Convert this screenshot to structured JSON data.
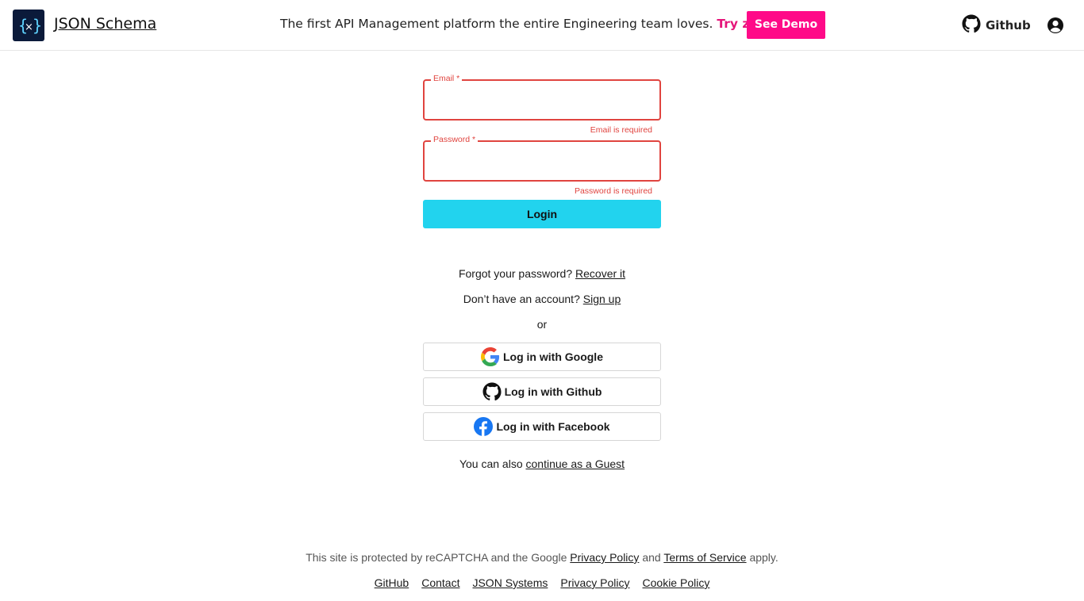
{
  "header": {
    "brand": "JSON Schema",
    "promo_text": "The first API Management platform the entire Engineering team loves.",
    "promo_link": "Try zuplo",
    "demo_button": "See Demo",
    "github_label": "Github",
    "logo_icon": "json-schema-logo-icon",
    "account_icon": "user-circle-icon"
  },
  "form": {
    "email_label": "Email *",
    "email_value": "",
    "email_error": "Email is required",
    "password_label": "Password *",
    "password_value": "",
    "password_error": "Password is required",
    "login_button": "Login"
  },
  "links": {
    "forgot_text": "Forgot your password?",
    "recover_link": "Recover it",
    "no_account_text": "Don’t have an account?",
    "signup_link": "Sign up",
    "or_text": "or"
  },
  "social": {
    "google": "Log in with Google",
    "github": "Log in with Github",
    "facebook": "Log in with Facebook"
  },
  "guest": {
    "text": "You can also",
    "link": "continue as a Guest"
  },
  "footer": {
    "recaptcha_text": "This site is protected by reCAPTCHA and the Google",
    "privacy_link": "Privacy Policy",
    "and_text": "and",
    "terms_link": "Terms of Service",
    "apply_text": "apply.",
    "links": [
      "GitHub",
      "Contact",
      "JSON Systems",
      "Privacy Policy",
      "Cookie Policy"
    ]
  },
  "colors": {
    "accent_pink": "#ff0a88",
    "error_red": "#e0443f",
    "login_cyan": "#22d3ee",
    "logo_bg": "#0b1a3a"
  }
}
